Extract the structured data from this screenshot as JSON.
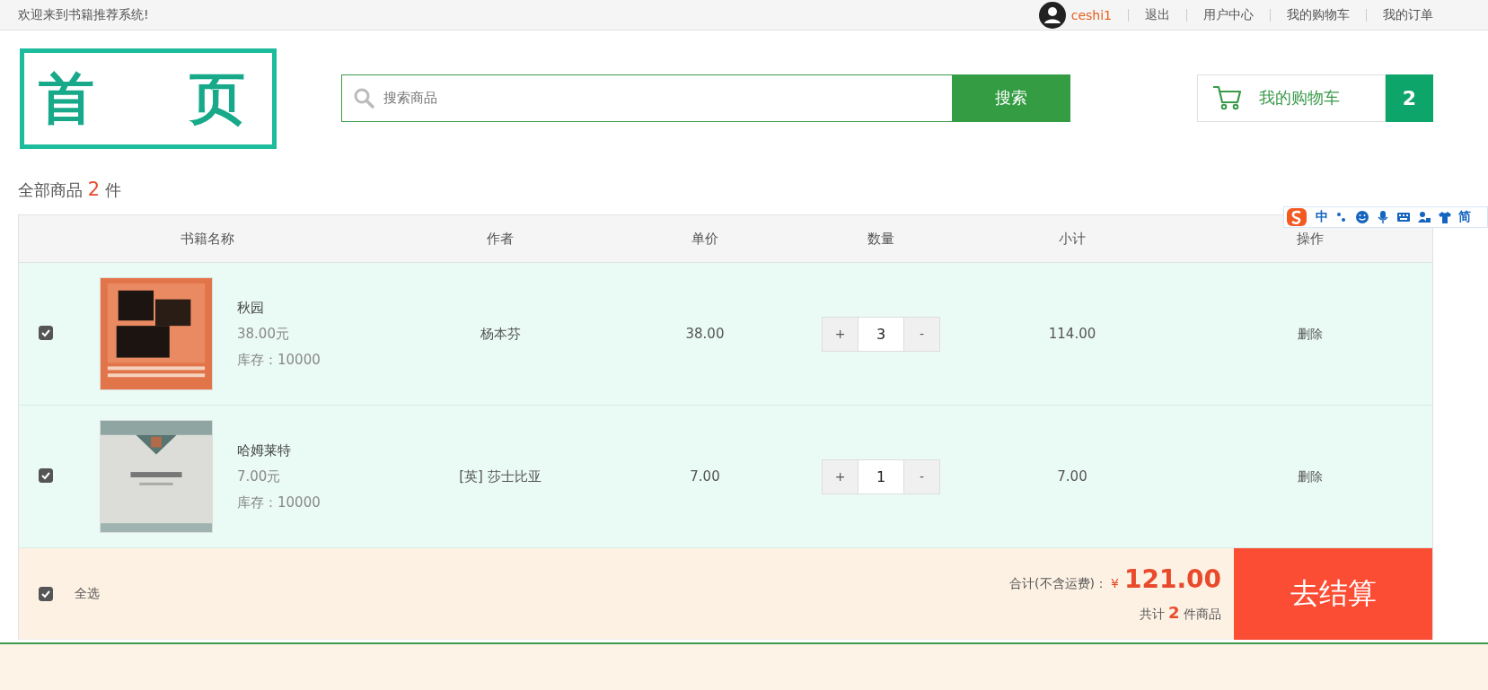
{
  "top_bar": {
    "welcome": "欢迎来到书籍推荐系统!",
    "username": "ceshi1",
    "links": [
      "退出",
      "用户中心",
      "我的购物车",
      "我的订单"
    ]
  },
  "logo": {
    "chars": [
      "首",
      "页"
    ]
  },
  "search": {
    "placeholder": "搜索商品",
    "button": "搜索"
  },
  "cart": {
    "label": "我的购物车",
    "count": "2"
  },
  "summary": {
    "label": "全部商品",
    "count": "2",
    "unit": "件"
  },
  "table": {
    "columns": [
      "书籍名称",
      "作者",
      "单价",
      "数量",
      "小计",
      "操作"
    ],
    "rows": [
      {
        "checked": true,
        "title": "秋园",
        "price": "38.00元",
        "stock": "库存：10000",
        "author": "杨本芬",
        "unit_price": "38.00",
        "quantity": "3",
        "subtotal": "114.00",
        "action": "删除"
      },
      {
        "checked": true,
        "title": "哈姆莱特",
        "price": "7.00元",
        "stock": "库存：10000",
        "author": "[英] 莎士比亚",
        "unit_price": "7.00",
        "quantity": "1",
        "subtotal": "7.00",
        "action": "删除"
      }
    ]
  },
  "footer": {
    "select_all": {
      "checked": true,
      "label": "全选"
    },
    "total_label": "合计(不含运费)：",
    "currency": "¥",
    "total": "121.00",
    "count_prefix": "共计",
    "count": "2",
    "count_suffix": "件商品",
    "checkout": "去结算"
  },
  "qty_buttons": {
    "plus": "+",
    "minus": "-"
  },
  "ime_toolbar": {
    "labels": [
      "中",
      "简"
    ]
  }
}
